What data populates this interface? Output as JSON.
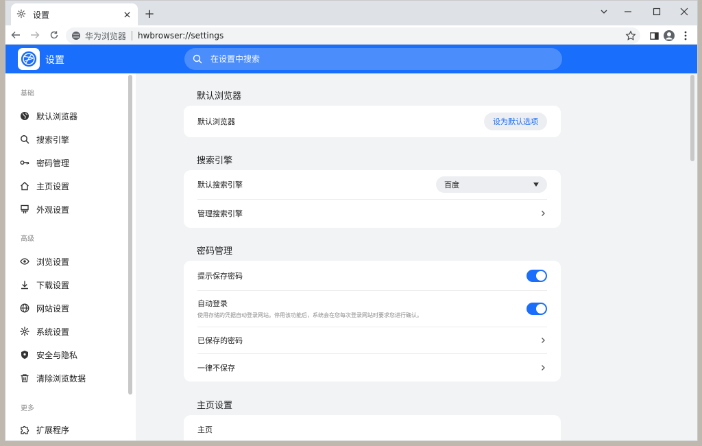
{
  "browser": {
    "tab_title": "设置",
    "tab_icon": "gear-icon",
    "new_tab_label": "+",
    "site_name": "华为浏览器",
    "url_scheme": "hwbrowser://",
    "url_path": "settings"
  },
  "header": {
    "title": "设置",
    "search_placeholder": "在设置中搜索",
    "accent_color": "#1a6efc"
  },
  "sidebar": {
    "sections": [
      {
        "label": "基础",
        "items": [
          {
            "label": "默认浏览器",
            "icon": "globe-icon"
          },
          {
            "label": "搜索引擎",
            "icon": "search-icon"
          },
          {
            "label": "密码管理",
            "icon": "key-icon"
          },
          {
            "label": "主页设置",
            "icon": "home-icon"
          },
          {
            "label": "外观设置",
            "icon": "appearance-icon"
          }
        ]
      },
      {
        "label": "高级",
        "items": [
          {
            "label": "浏览设置",
            "icon": "eye-icon"
          },
          {
            "label": "下载设置",
            "icon": "download-icon"
          },
          {
            "label": "网站设置",
            "icon": "website-globe-icon"
          },
          {
            "label": "系统设置",
            "icon": "gear-icon"
          },
          {
            "label": "安全与隐私",
            "icon": "shield-icon"
          },
          {
            "label": "清除浏览数据",
            "icon": "trash-icon"
          }
        ]
      },
      {
        "label": "更多",
        "items": [
          {
            "label": "扩展程序",
            "icon": "puzzle-icon"
          }
        ]
      }
    ]
  },
  "main": {
    "default_browser": {
      "title": "默认浏览器",
      "row_label": "默认浏览器",
      "button_label": "设为默认选项"
    },
    "search_engine": {
      "title": "搜索引擎",
      "default_label": "默认搜索引擎",
      "default_value": "百度",
      "manage_label": "管理搜索引擎"
    },
    "passwords": {
      "title": "密码管理",
      "offer_save_label": "提示保存密码",
      "offer_save_on": true,
      "auto_signin_label": "自动登录",
      "auto_signin_desc": "使用存储的凭据自动登录网站。停用该功能后，系统会在您每次登录网站时要求您进行确认。",
      "auto_signin_on": true,
      "saved_label": "已保存的密码",
      "never_saved_label": "一律不保存"
    },
    "homepage": {
      "title": "主页设置",
      "home_label": "主页"
    }
  }
}
